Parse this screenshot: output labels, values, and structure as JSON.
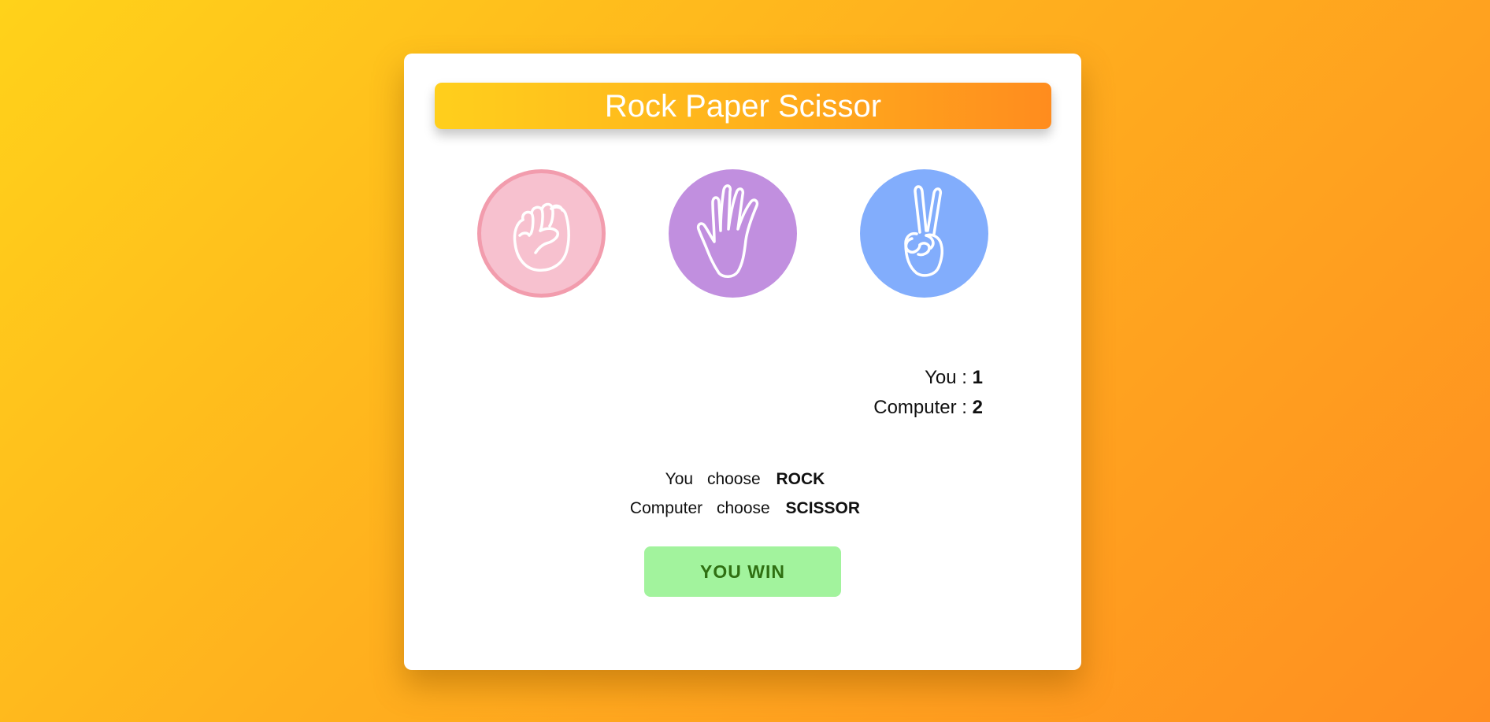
{
  "app": {
    "title": "Rock Paper Scissor"
  },
  "choices": [
    {
      "name": "rock",
      "icon": "fist-icon",
      "color": "#f7c1cf",
      "selected": true
    },
    {
      "name": "paper",
      "icon": "open-hand-icon",
      "color": "#c18fdf",
      "selected": false
    },
    {
      "name": "scissor",
      "icon": "peace-hand-icon",
      "color": "#82adfc",
      "selected": false
    }
  ],
  "score": {
    "you_label": "You :",
    "you_value": "1",
    "computer_label": "Computer :",
    "computer_value": "2"
  },
  "round": {
    "you_word": "You",
    "you_verb": "choose",
    "you_choice": "ROCK",
    "computer_word": "Computer",
    "computer_verb": "choose",
    "computer_choice": "SCISSOR"
  },
  "result": {
    "label": "YOU WIN",
    "color": "#a2f39d"
  },
  "colors": {
    "background_start": "#ffd21a",
    "background_end": "#ff8e20",
    "title_bar_start": "#ffcf1c",
    "title_bar_end": "#ff8c1e"
  }
}
